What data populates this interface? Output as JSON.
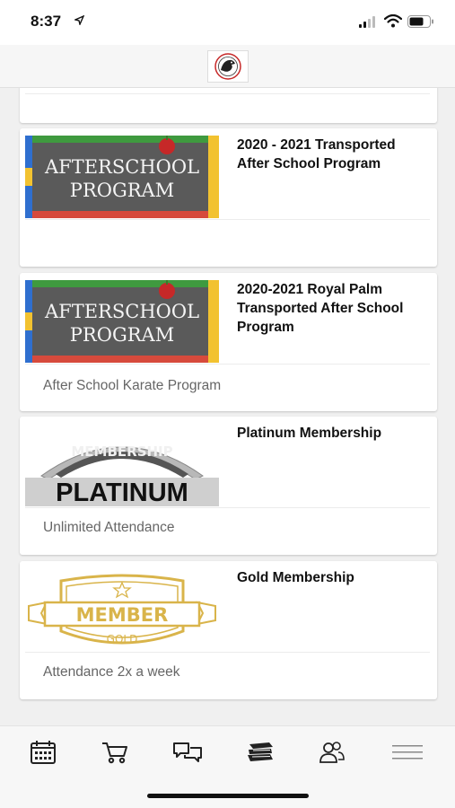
{
  "status_bar": {
    "time": "8:37"
  },
  "header": {
    "logo": "school-logo"
  },
  "cards": [
    {
      "title": "",
      "description": ""
    },
    {
      "title": "2020 - 2021 Transported After School Program",
      "thumb_text_1": "AFTERSCHOOL",
      "thumb_text_2": "PROGRAM",
      "description": ""
    },
    {
      "title": "2020-2021 Royal Palm Transported After School Program",
      "thumb_text_1": "AFTERSCHOOL",
      "thumb_text_2": "PROGRAM",
      "description": "After School Karate Program"
    },
    {
      "title": "Platinum Membership",
      "thumb_badge": "MEMBERSHIP",
      "thumb_main": "PLATINUM",
      "description": "Unlimited Attendance"
    },
    {
      "title": "Gold Membership",
      "thumb_main": "MEMBER",
      "thumb_sub": "GOLD",
      "description": "Attendance 2x a week"
    }
  ],
  "tabbar": {
    "tabs": [
      {
        "icon": "calendar-icon"
      },
      {
        "icon": "cart-icon"
      },
      {
        "icon": "chat-icon"
      },
      {
        "icon": "books-icon"
      },
      {
        "icon": "users-icon"
      },
      {
        "icon": "menu-icon"
      }
    ]
  },
  "colors": {
    "gold": "#d9b44a",
    "accent_red": "#c62828",
    "text_muted": "#666666"
  }
}
